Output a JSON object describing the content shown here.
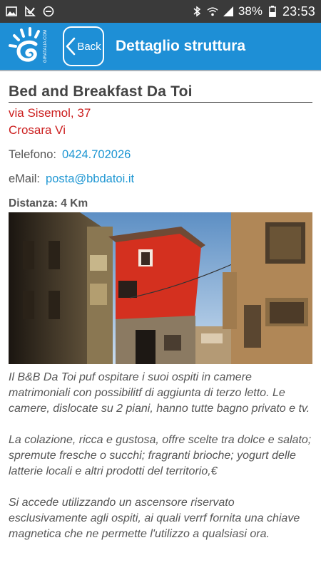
{
  "status_bar": {
    "battery": "38%",
    "time": "23:53"
  },
  "app_bar": {
    "logo_text": "GIRATALIA.COM",
    "back_label": "Back",
    "title": "Dettaglio struttura"
  },
  "structure": {
    "name": "Bed and Breakfast Da Toi",
    "address_line1": "via Sisemol, 37",
    "address_line2": "Crosara  Vi",
    "phone_label": "Telefono:",
    "phone_value": "0424.702026",
    "email_label": "eMail:",
    "email_value": "posta@bbdatoi.it",
    "distance": "Distanza: 4 Km",
    "description": [
      "Il B&B Da Toi puf ospitare i suoi ospiti in camere matrimoniali con possibilitf di aggiunta di terzo letto. Le camere, dislocate su 2 piani, hanno tutte bagno privato e tv.",
      "La colazione, ricca e gustosa, offre scelte tra dolce e salato; spremute fresche o succhi; fragranti brioche; yogurt delle latterie locali e altri prodotti del territorio,€",
      "Si accede utilizzando un ascensore riservato esclusivamente agli ospiti, ai quali verrf fornita una chiave magnetica che ne permette l'utilizzo a qualsiasi ora."
    ]
  },
  "colors": {
    "app_bar": "#1e8fd6",
    "address": "#cc1f1f",
    "link": "#1f97d3"
  }
}
